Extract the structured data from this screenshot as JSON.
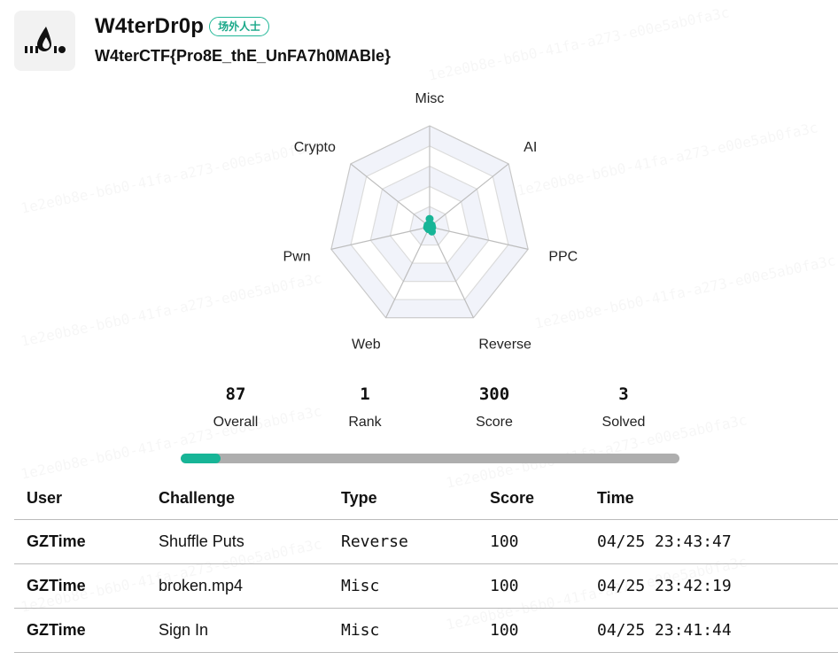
{
  "team": {
    "name": "W4terDr0p",
    "badge": "场外人士",
    "slogan": "W4terCTF{Pro8E_thE_UnFA7h0MABle}"
  },
  "watermark": "1e2e0b8e-b6b0-41fa-a273-e00e5ab0fa3c",
  "radar": {
    "categories": [
      "Misc",
      "AI",
      "PPC",
      "Reverse",
      "Web",
      "Pwn",
      "Crypto"
    ],
    "values": [
      0.06,
      0,
      0,
      0.04,
      0,
      0,
      0
    ],
    "accent": "#17b597"
  },
  "stats": [
    {
      "value": "87",
      "label": "Overall"
    },
    {
      "value": "1",
      "label": "Rank"
    },
    {
      "value": "300",
      "label": "Score"
    },
    {
      "value": "3",
      "label": "Solved"
    }
  ],
  "progress": {
    "fraction": 0.08,
    "fill_color": "#17b597",
    "track_color": "#aeaeae"
  },
  "table": {
    "headers": [
      "User",
      "Challenge",
      "Type",
      "Score",
      "Time"
    ],
    "rows": [
      {
        "user": "GZTime",
        "challenge": "Shuffle Puts",
        "type": "Reverse",
        "score": "100",
        "time": "04/25 23:43:47"
      },
      {
        "user": "GZTime",
        "challenge": "broken.mp4",
        "type": "Misc",
        "score": "100",
        "time": "04/25 23:42:19"
      },
      {
        "user": "GZTime",
        "challenge": "Sign In",
        "type": "Misc",
        "score": "100",
        "time": "04/25 23:41:44"
      }
    ]
  }
}
